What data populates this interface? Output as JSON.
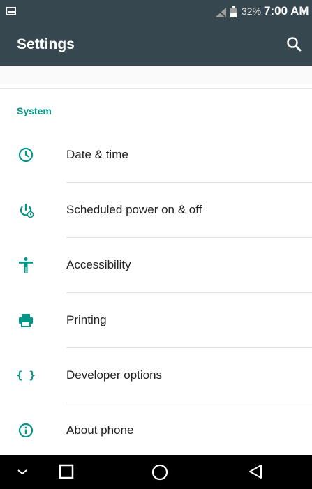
{
  "status_bar": {
    "battery": "32%",
    "time": "7:00 AM"
  },
  "toolbar": {
    "title": "Settings"
  },
  "section": {
    "title": "System"
  },
  "items": [
    {
      "label": "Date & time",
      "icon": "clock-icon"
    },
    {
      "label": "Scheduled power on & off",
      "icon": "power-schedule-icon"
    },
    {
      "label": "Accessibility",
      "icon": "accessibility-icon"
    },
    {
      "label": "Printing",
      "icon": "printer-icon"
    },
    {
      "label": "Developer options",
      "icon": "braces-icon"
    },
    {
      "label": "About phone",
      "icon": "info-icon"
    }
  ],
  "colors": {
    "accent": "#009688",
    "toolbar": "#37474f",
    "navbar": "#000000"
  }
}
